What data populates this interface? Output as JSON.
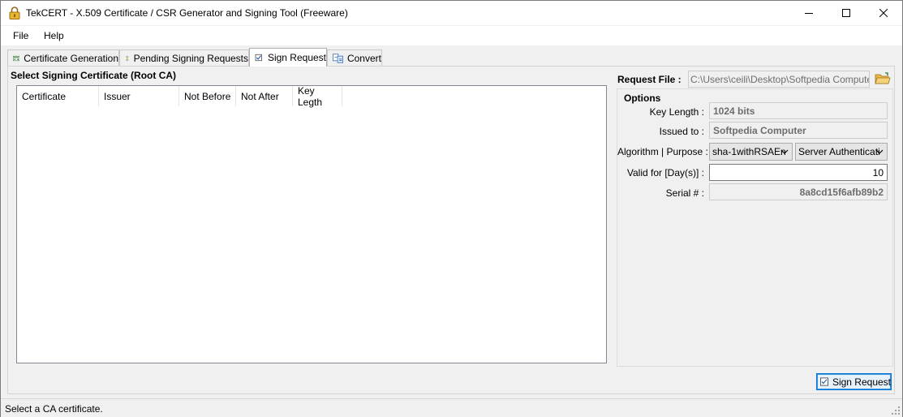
{
  "window": {
    "title": "TekCERT - X.509 Certificate / CSR Generator and Signing Tool (Freeware)"
  },
  "menu": [
    "File",
    "Help"
  ],
  "tabs": [
    {
      "label": "Certificate Generation",
      "icon": "certificate-icon"
    },
    {
      "label": "Pending Signing Requests",
      "icon": "hourglass-icon"
    },
    {
      "label": "Sign Request",
      "icon": "checkbox-icon",
      "active": true
    },
    {
      "label": "Convert",
      "icon": "convert-icon"
    }
  ],
  "left": {
    "title": "Select Signing Certificate (Root CA)",
    "columns": [
      "Certificate",
      "Issuer",
      "Not Before",
      "Not After",
      "Key Legth"
    ]
  },
  "request": {
    "label": "Request File :",
    "path": "C:\\Users\\ceili\\Desktop\\Softpedia Computer.c"
  },
  "options": {
    "title": "Options",
    "key_length_label": "Key Length :",
    "key_length": "1024 bits",
    "issued_to_label": "Issued to :",
    "issued_to": "Softpedia Computer",
    "algorithm_label": "Algorithm | Purpose :",
    "algorithm": "sha-1withRSAEn",
    "purpose": "Server Authenticati",
    "valid_label": "Valid for [Day(s)] :",
    "valid_days": "10",
    "serial_label": "Serial # :",
    "serial": "8a8cd15f6afb89b2"
  },
  "sign_button": "Sign Request",
  "status": "Select a CA certificate.",
  "colors": {
    "accent": "#0078d7",
    "button_bg": "#e5f1fb"
  }
}
